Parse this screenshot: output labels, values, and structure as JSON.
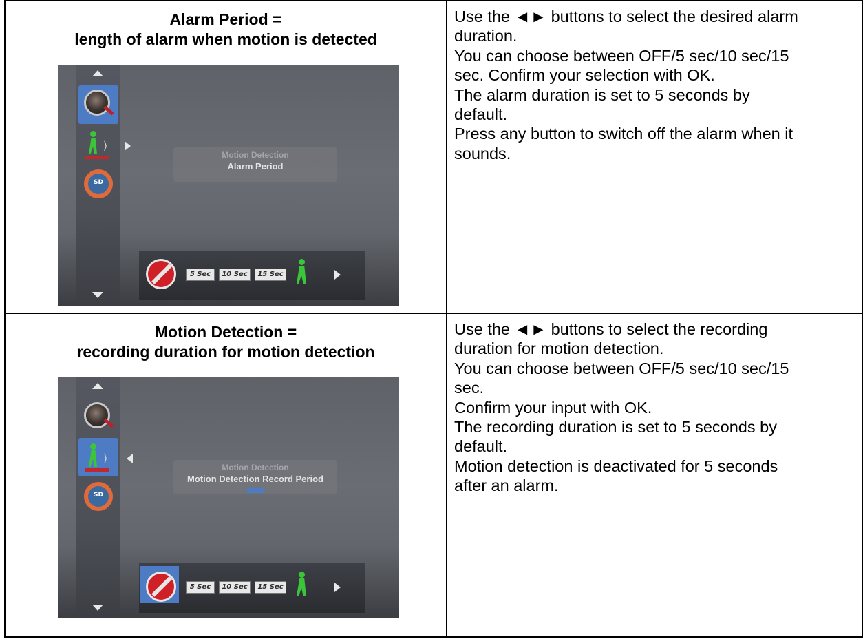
{
  "rows": [
    {
      "heading_lines": [
        "Alarm Period =",
        "length of alarm when motion is detected"
      ],
      "screen": {
        "menu_title_dim": "Motion Detection",
        "menu_title": "Alarm Period",
        "selected_sidebar": "motion",
        "selected_bar": "none",
        "buttons": [
          "5 Sec",
          "10 Sec",
          "15 Sec"
        ]
      },
      "description_lines": [
        "Use the ◄► buttons to select the desired alarm",
        "duration.",
        "You can choose between OFF/5 sec/10 sec/15",
        "sec. Confirm your selection with OK.",
        "The alarm duration is set to 5 seconds by",
        "default.",
        "Press any button to switch off the alarm when it",
        "sounds."
      ]
    },
    {
      "heading_lines": [
        "Motion Detection =",
        "recording duration for motion detection"
      ],
      "screen": {
        "menu_title_dim": "Motion Detection",
        "menu_title": "Motion Detection Record Period",
        "selected_sidebar": "motion",
        "selected_bar": "off",
        "buttons": [
          "5 Sec",
          "10 Sec",
          "15 Sec"
        ]
      },
      "description_lines": [
        "Use the ◄► buttons to select the recording",
        "duration for motion detection.",
        "You can choose between OFF/5 sec/10 sec/15",
        "sec.",
        "Confirm your input with OK.",
        "The recording duration is set to 5 seconds by",
        "default.",
        "Motion detection is deactivated for 5 seconds",
        "after an alarm."
      ]
    }
  ],
  "colors": {
    "accent": "#4d7bc4",
    "screen_bg": "#63666c",
    "icon_green": "#3cc43a",
    "icon_red": "#c0282c"
  },
  "icons": [
    "arrow-up-icon",
    "magnifier-icon",
    "motion-person-icon",
    "sd-card-icon",
    "arrow-down-icon",
    "off-icon",
    "running-person-icon",
    "arrow-right-icon"
  ]
}
